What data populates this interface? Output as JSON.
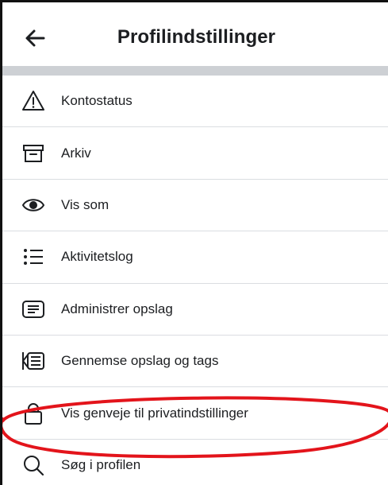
{
  "header": {
    "title": "Profilindstillinger",
    "back_icon": "arrow-left-icon"
  },
  "menu": {
    "items": [
      {
        "label": "Kontostatus",
        "icon": "warning-icon"
      },
      {
        "label": "Arkiv",
        "icon": "archive-icon"
      },
      {
        "label": "Vis som",
        "icon": "eye-icon"
      },
      {
        "label": "Aktivitetslog",
        "icon": "list-icon"
      },
      {
        "label": "Administrer opslag",
        "icon": "post-icon"
      },
      {
        "label": "Gennemse opslag og tags",
        "icon": "review-posts-icon"
      },
      {
        "label": "Vis genveje til privatindstillinger",
        "icon": "lock-icon"
      },
      {
        "label": "Søg i profilen",
        "icon": "search-icon"
      }
    ]
  },
  "annotation": {
    "color": "#e3141b"
  }
}
